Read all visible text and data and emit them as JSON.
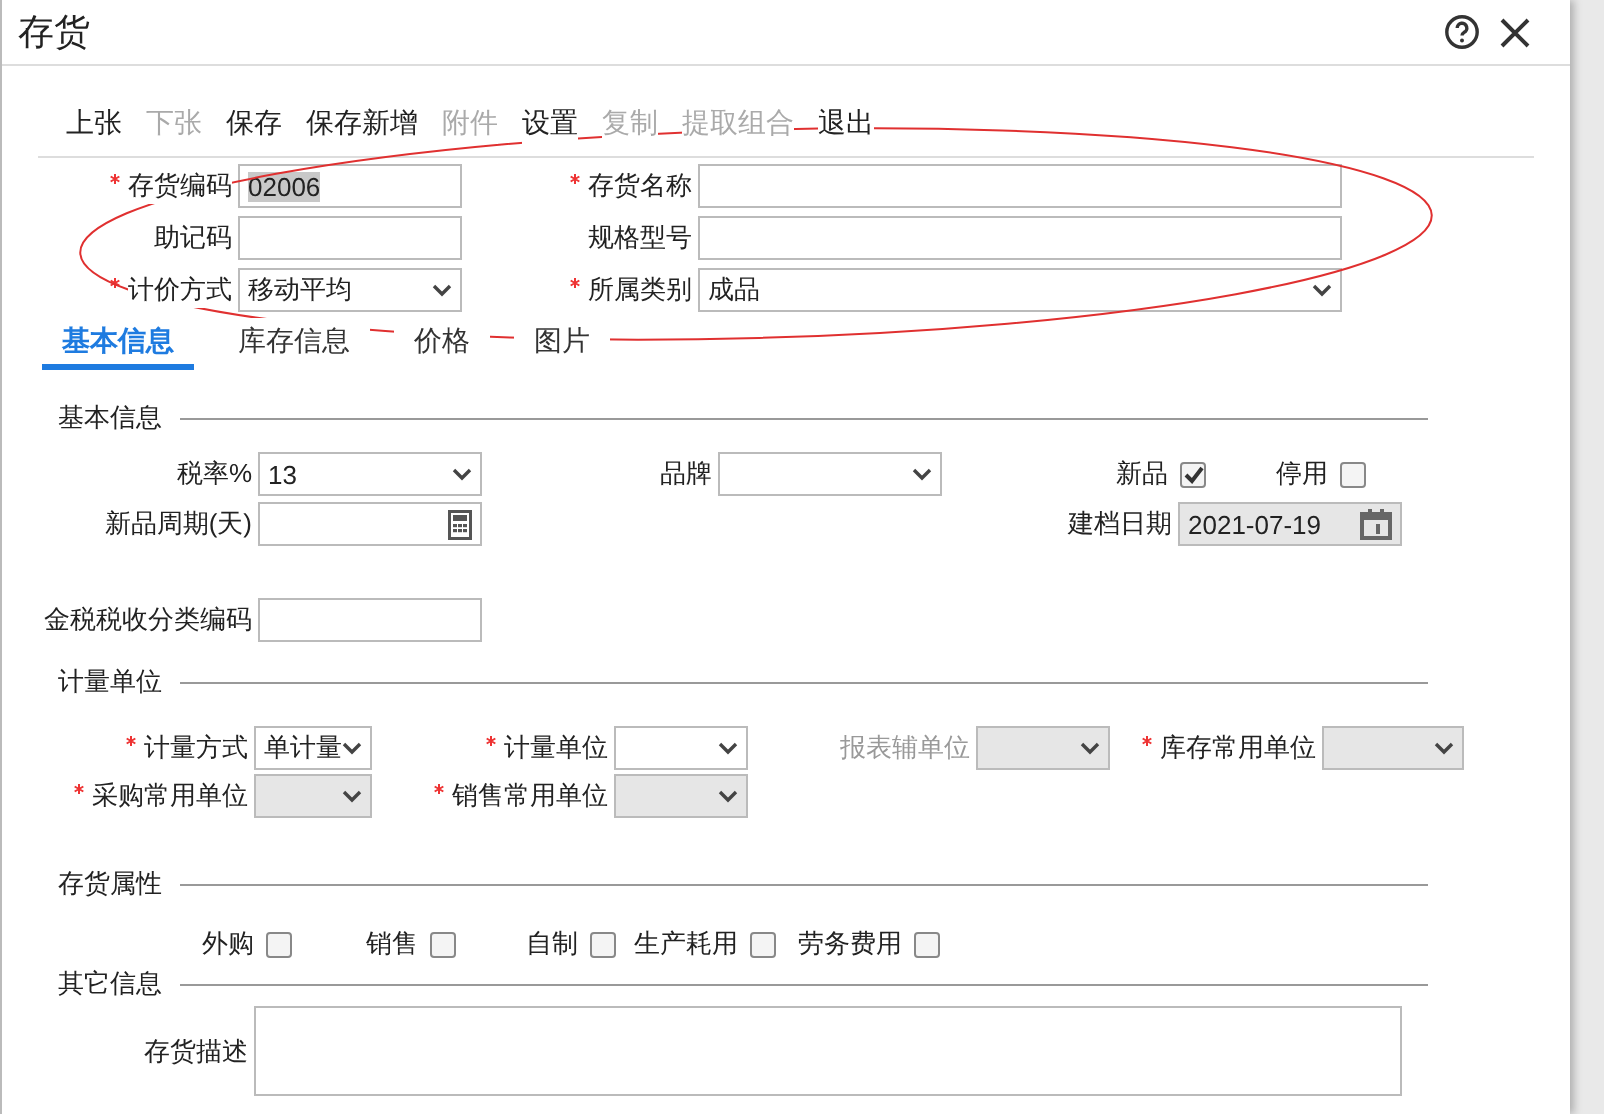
{
  "window": {
    "title": "存货"
  },
  "toolbar": [
    {
      "label": "上张",
      "disabled": false
    },
    {
      "label": "下张",
      "disabled": true
    },
    {
      "label": "保存",
      "disabled": false
    },
    {
      "label": "保存新增",
      "disabled": false
    },
    {
      "label": "附件",
      "disabled": true
    },
    {
      "label": "设置",
      "disabled": false
    },
    {
      "label": "复制",
      "disabled": true
    },
    {
      "label": "提取组合",
      "disabled": true
    },
    {
      "label": "退出",
      "disabled": false
    }
  ],
  "header_rows": [
    [
      {
        "kind": "text",
        "label": "存货编码",
        "required": true,
        "value": "02006",
        "value_selected": true
      },
      {
        "kind": "text",
        "label": "存货名称",
        "required": true
      }
    ],
    [
      {
        "kind": "text",
        "label": "助记码",
        "required": false
      },
      {
        "kind": "text",
        "label": "规格型号",
        "required": false
      }
    ],
    [
      {
        "kind": "select",
        "label": "计价方式",
        "required": true,
        "value": "移动平均",
        "disabled": false
      },
      {
        "kind": "select",
        "label": "所属类别",
        "required": true,
        "value": "成品",
        "disabled": false
      }
    ]
  ],
  "tabs": [
    {
      "label": "基本信息",
      "selected": true
    },
    {
      "label": "库存信息",
      "selected": false
    },
    {
      "label": "价格",
      "selected": false
    },
    {
      "label": "图片",
      "selected": false
    }
  ],
  "sections": [
    {
      "title": "基本信息",
      "rows": [
        [
          {
            "kind": "select",
            "label": "税率%",
            "required": false,
            "value": "13",
            "disabled": false
          },
          {
            "kind": "select",
            "label": "品牌",
            "required": false,
            "disabled": false
          },
          {
            "kind": "checkbox",
            "label": "新品",
            "checked": true
          },
          {
            "kind": "checkbox",
            "label": "停用",
            "checked": false
          }
        ],
        [
          {
            "kind": "calc",
            "label": "新品周期(天)",
            "required": false
          },
          "",
          {
            "kind": "date",
            "label": "建档日期",
            "required": false,
            "value": "2021-07-19",
            "disabled": true
          }
        ],
        [
          {
            "kind": "text",
            "label": "金税税收分类编码",
            "required": false
          }
        ]
      ]
    },
    {
      "title": "计量单位",
      "rows": [
        [
          {
            "kind": "select",
            "label": "计量方式",
            "required": true,
            "value": "单计量",
            "disabled": false,
            "label_disabled": false
          },
          {
            "kind": "select",
            "label": "计量单位",
            "required": true,
            "disabled": false,
            "label_disabled": false
          },
          {
            "kind": "select",
            "label": "报表辅单位",
            "required": false,
            "disabled": true,
            "label_disabled": true
          },
          {
            "kind": "select",
            "label": "库存常用单位",
            "required": true,
            "disabled": true,
            "label_disabled": false
          }
        ],
        [
          {
            "kind": "select",
            "label": "采购常用单位",
            "required": true,
            "disabled": true,
            "label_disabled": false
          },
          {
            "kind": "select",
            "label": "销售常用单位",
            "required": true,
            "disabled": true,
            "label_disabled": false
          }
        ]
      ]
    },
    {
      "title": "存货属性",
      "rows": [
        [
          {
            "kind": "checkbox",
            "label": "外购",
            "checked": false
          },
          {
            "kind": "checkbox",
            "label": "销售",
            "checked": false
          },
          {
            "kind": "checkbox",
            "label": "自制",
            "checked": false
          },
          {
            "kind": "checkbox",
            "label": "生产耗用",
            "checked": false
          },
          {
            "kind": "checkbox",
            "label": "劳务费用",
            "checked": false
          }
        ]
      ]
    },
    {
      "title": "其它信息",
      "rows": [
        [
          {
            "kind": "textarea",
            "label": "存货描述",
            "required": false
          }
        ]
      ]
    }
  ]
}
